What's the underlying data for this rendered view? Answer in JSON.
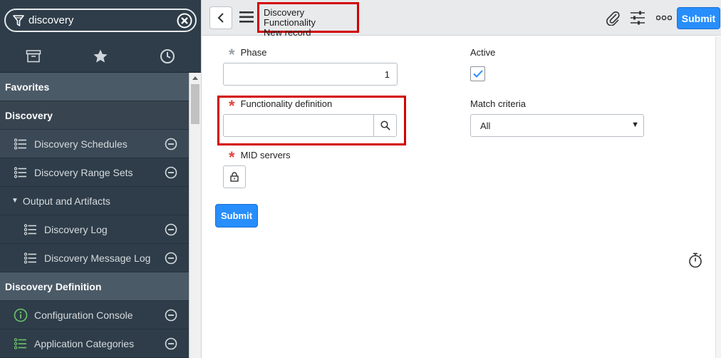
{
  "sidebar": {
    "filter": {
      "value": "discovery"
    },
    "tabs": [
      {
        "icon": "archive-icon"
      },
      {
        "icon": "star-icon"
      },
      {
        "icon": "clock-icon"
      }
    ],
    "rows": [
      {
        "type": "section",
        "label": "Favorites"
      },
      {
        "type": "section",
        "label": "Discovery"
      },
      {
        "type": "item",
        "label": "Discovery Schedules",
        "icon": "list-icon"
      },
      {
        "type": "item",
        "label": "Discovery Range Sets",
        "icon": "list-icon"
      },
      {
        "type": "group",
        "label": "Output and Artifacts"
      },
      {
        "type": "sub",
        "label": "Discovery Log",
        "icon": "list-icon"
      },
      {
        "type": "sub",
        "label": "Discovery Message Log",
        "icon": "list-icon"
      },
      {
        "type": "section",
        "label": "Discovery Definition"
      },
      {
        "type": "item",
        "label": "Configuration Console",
        "icon": "info-circle-icon"
      },
      {
        "type": "item",
        "label": "Application Categories",
        "icon": "list-icon"
      }
    ]
  },
  "header": {
    "title": "Discovery Functionality",
    "subtitle": "New record",
    "submit_label": "Submit"
  },
  "form": {
    "phase": {
      "label": "Phase",
      "value": "1"
    },
    "functionality_definition": {
      "label": "Functionality definition",
      "value": ""
    },
    "mid_servers": {
      "label": "MID servers"
    },
    "active": {
      "label": "Active",
      "checked": true
    },
    "match_criteria": {
      "label": "Match criteria",
      "value": "All"
    },
    "submit_label": "Submit"
  },
  "colors": {
    "sidebar_bg": "#2e3d49",
    "accent": "#278efc",
    "highlight_border": "#d40000",
    "required": "#e0433f"
  }
}
